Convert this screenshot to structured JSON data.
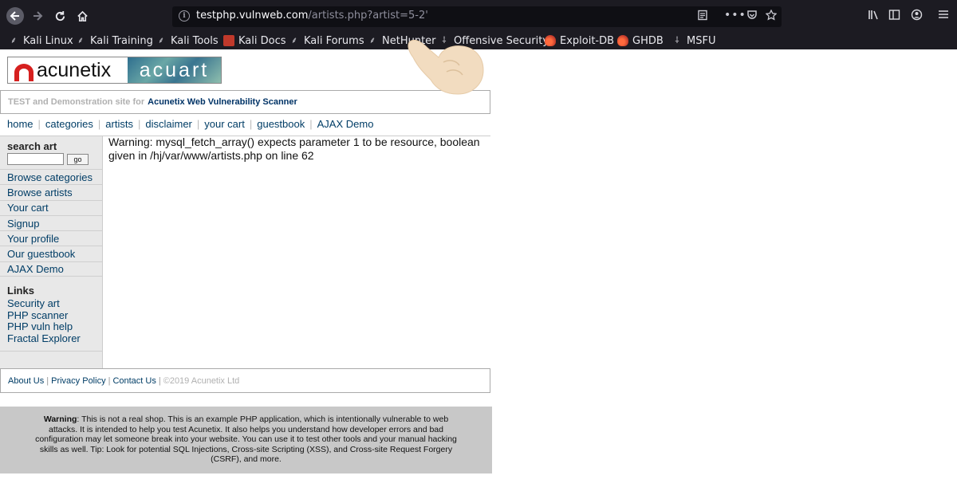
{
  "browser": {
    "url_host": "testphp.vulnweb.com",
    "url_path": "/artists.php?artist=5-2'",
    "bookmarks": [
      {
        "label": "Kali Linux",
        "icon": "kali-dragon-icon"
      },
      {
        "label": "Kali Training",
        "icon": "kali-dragon-icon"
      },
      {
        "label": "Kali Tools",
        "icon": "kali-dragon-icon"
      },
      {
        "label": "Kali Docs",
        "icon": "kali-docs-icon"
      },
      {
        "label": "Kali Forums",
        "icon": "kali-dragon-icon"
      },
      {
        "label": "NetHunter",
        "icon": "kali-dragon-icon"
      },
      {
        "label": "Offensive Security",
        "icon": "offsec-icon"
      },
      {
        "label": "Exploit-DB",
        "icon": "exploit-db-icon"
      },
      {
        "label": "GHDB",
        "icon": "ghdb-icon"
      },
      {
        "label": "MSFU",
        "icon": "msfu-icon"
      }
    ]
  },
  "site": {
    "logo_left": "acunetix",
    "logo_right": "acuart",
    "tagline_prefix": "TEST and Demonstration site for",
    "tagline_link": "Acunetix Web Vulnerability Scanner",
    "top_menu": [
      "home",
      "categories",
      "artists",
      "disclaimer",
      "your cart",
      "guestbook",
      "AJAX Demo"
    ],
    "search_title": "search art",
    "search_button": "go",
    "side_nav": [
      "Browse categories",
      "Browse artists",
      "Your cart",
      "Signup",
      "Your profile",
      "Our guestbook",
      "AJAX Demo"
    ],
    "links_title": "Links",
    "links": [
      "Security art",
      "PHP scanner",
      "PHP vuln help",
      "Fractal Explorer"
    ],
    "warning_message": "Warning: mysql_fetch_array() expects parameter 1 to be resource, boolean given in /hj/var/www/artists.php on line 62",
    "footer_links": [
      "About Us",
      "Privacy Policy",
      "Contact Us"
    ],
    "copyright": "©2019 Acunetix Ltd",
    "disclaimer_bold": "Warning",
    "disclaimer_text": ": This is not a real shop. This is an example PHP application, which is intentionally vulnerable to web attacks. It is intended to help you test Acunetix. It also helps you understand how developer errors and bad configuration may let someone break into your website. You can use it to test other tools and your manual hacking skills as well. Tip: Look for potential SQL Injections, Cross-site Scripting (XSS), and Cross-site Request Forgery (CSRF), and more."
  }
}
